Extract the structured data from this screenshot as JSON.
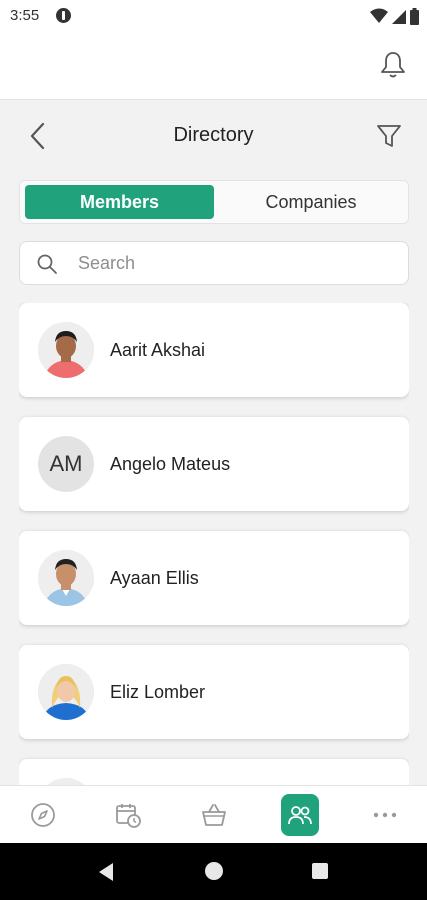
{
  "status_bar": {
    "time": "3:55"
  },
  "header": {
    "title": "Directory"
  },
  "tabs": {
    "members": "Members",
    "companies": "Companies",
    "active": "Members"
  },
  "search": {
    "placeholder": "Search",
    "value": ""
  },
  "members": [
    {
      "name": "Aarit Akshai",
      "avatar": "photo",
      "initials": ""
    },
    {
      "name": "Angelo Mateus",
      "avatar": "initials",
      "initials": "AM"
    },
    {
      "name": "Ayaan Ellis",
      "avatar": "photo",
      "initials": ""
    },
    {
      "name": "Eliz Lomber",
      "avatar": "photo",
      "initials": ""
    },
    {
      "name": "",
      "avatar": "photo",
      "initials": ""
    }
  ],
  "bottom_nav": {
    "items": [
      {
        "icon": "compass-icon",
        "active": false
      },
      {
        "icon": "calendar-clock-icon",
        "active": false
      },
      {
        "icon": "basket-icon",
        "active": false
      },
      {
        "icon": "people-icon",
        "active": true
      },
      {
        "icon": "more-icon",
        "active": false
      }
    ]
  },
  "colors": {
    "accent": "#20a27c",
    "background": "#f2f2f2",
    "card": "#ffffff"
  }
}
